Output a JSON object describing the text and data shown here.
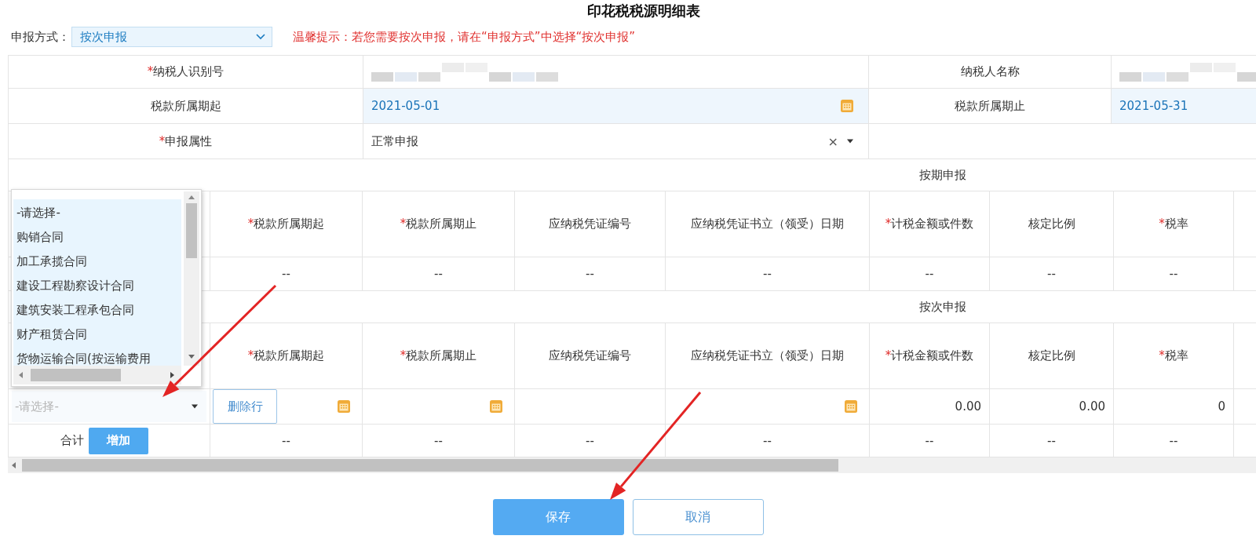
{
  "title": "印花税税源明细表",
  "declare_mode": {
    "label": "申报方式：",
    "value": "按次申报"
  },
  "hint": "温馨提示：若您需要按次申报，请在“申报方式”中选择“按次申报”",
  "form": {
    "fields": [
      {
        "label": "纳税人识别号",
        "mark": "*",
        "kind": "masked"
      },
      {
        "label": "纳税人名称",
        "kind": "masked"
      },
      {
        "label": "税款所属期起",
        "kind": "date",
        "value": "2021-05-01",
        "calendar_icon": true
      },
      {
        "label": "税款所属期止",
        "kind": "date",
        "value": "2021-05-31"
      },
      {
        "label": "申报属性",
        "mark": "*",
        "kind": "select",
        "value": "正常申报",
        "clear": "×"
      }
    ]
  },
  "sections": [
    {
      "title": "按期申报",
      "columns": [
        {
          "label": "税款所属期起",
          "mark": "*"
        },
        {
          "label": "税款所属期止",
          "mark": "*"
        },
        {
          "label": "应纳税凭证编号"
        },
        {
          "label": "应纳税凭证书立（领受）日期"
        },
        {
          "label": "计税金额或件数",
          "mark": "*"
        },
        {
          "label": "核定比例"
        },
        {
          "label": "税率",
          "mark": "*"
        }
      ],
      "rows": [
        {
          "kind": "static",
          "cells": [
            "--",
            "--",
            "--",
            "--",
            "--",
            "--",
            "--"
          ]
        }
      ]
    },
    {
      "title": "按次申报",
      "columns": [
        {
          "label": "税款所属期起",
          "mark": "*"
        },
        {
          "label": "税款所属期止",
          "mark": "*"
        },
        {
          "label": "应纳税凭证编号"
        },
        {
          "label": "应纳税凭证书立（领受）日期"
        },
        {
          "label": "计税金额或件数",
          "mark": "*"
        },
        {
          "label": "核定比例"
        },
        {
          "label": "税率",
          "mark": "*"
        }
      ],
      "rows": [
        {
          "kind": "input",
          "contract": {
            "placeholder": "-请选择-"
          },
          "delete_button": "删除行",
          "cells": [
            {
              "kind": "date"
            },
            {
              "kind": "date"
            },
            {
              "kind": "text"
            },
            {
              "kind": "date"
            },
            {
              "kind": "number",
              "value": "0.00"
            },
            {
              "kind": "number",
              "value": "0.00"
            },
            {
              "kind": "number",
              "value": "0"
            }
          ]
        },
        {
          "kind": "total",
          "label": "合计",
          "add_button": "增加",
          "cells": [
            "--",
            "--",
            "--",
            "--",
            "--",
            "--",
            "--"
          ]
        }
      ]
    }
  ],
  "dropdown": {
    "options": [
      {
        "label": "-请选择-",
        "selected": false
      },
      {
        "label": "购销合同",
        "selected": false
      },
      {
        "label": "加工承揽合同",
        "selected": false
      },
      {
        "label": "建设工程勘察设计合同",
        "selected": false
      },
      {
        "label": "建筑安装工程承包合同",
        "selected": false
      },
      {
        "label": "财产租赁合同",
        "selected": false
      },
      {
        "label": "货物运输合同(按运输费用",
        "selected": false
      }
    ]
  },
  "buttons": [
    {
      "label": "保存",
      "kind": "primary"
    },
    {
      "label": "取消",
      "kind": "secondary"
    }
  ]
}
